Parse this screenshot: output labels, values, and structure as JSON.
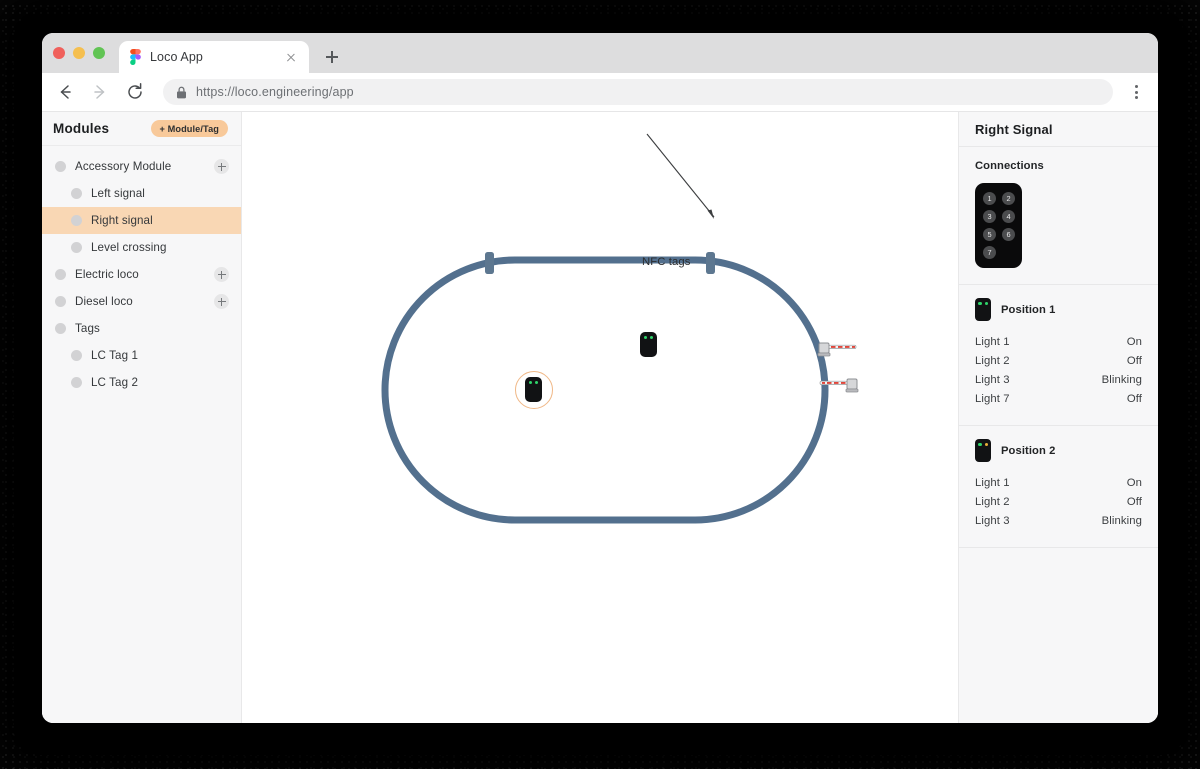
{
  "browser": {
    "tab": {
      "title": "Loco App",
      "favicon": "figma-logo-icon"
    },
    "new_tab_label": "+",
    "url": "https://loco.engineering/app",
    "nav": {
      "back": "back-arrow",
      "forward": "forward-arrow",
      "reload": "reload-icon",
      "lock": "lock-icon",
      "menu": "kebab-menu"
    }
  },
  "sidebar": {
    "title": "Modules",
    "add_button": "+ Module/Tag",
    "items": [
      {
        "label": "Accessory Module",
        "depth": 0,
        "selected": false,
        "has_add": true
      },
      {
        "label": "Left signal",
        "depth": 1,
        "selected": false,
        "has_add": false
      },
      {
        "label": "Right signal",
        "depth": 1,
        "selected": true,
        "has_add": false
      },
      {
        "label": "Level crossing",
        "depth": 1,
        "selected": false,
        "has_add": false
      },
      {
        "label": "Electric loco",
        "depth": 0,
        "selected": false,
        "has_add": true
      },
      {
        "label": "Diesel loco",
        "depth": 0,
        "selected": false,
        "has_add": true
      },
      {
        "label": "Tags",
        "depth": 0,
        "selected": false,
        "has_add": false
      },
      {
        "label": "LC Tag 1",
        "depth": 1,
        "selected": false,
        "has_add": false
      },
      {
        "label": "LC Tag 2",
        "depth": 1,
        "selected": false,
        "has_add": false
      }
    ]
  },
  "canvas": {
    "annotation": "NFC tags",
    "track_color": "#53708e",
    "marker_color": "#5d7790",
    "selection_color": "#f0b887"
  },
  "right_panel": {
    "title": "Right Signal",
    "connections": {
      "title": "Connections",
      "pins": [
        "1",
        "2",
        "3",
        "4",
        "5",
        "6",
        "7"
      ]
    },
    "positions": [
      {
        "name": "Position 1",
        "led_left": "green",
        "led_right": "green",
        "lights": [
          {
            "name": "Light 1",
            "value": "On"
          },
          {
            "name": "Light 2",
            "value": "Off"
          },
          {
            "name": "Light 3",
            "value": "Blinking"
          },
          {
            "name": "Light 7",
            "value": "Off"
          }
        ]
      },
      {
        "name": "Position 2",
        "led_left": "green",
        "led_right": "yellow",
        "lights": [
          {
            "name": "Light 1",
            "value": "On"
          },
          {
            "name": "Light 2",
            "value": "Off"
          },
          {
            "name": "Light 3",
            "value": "Blinking"
          }
        ]
      }
    ]
  }
}
